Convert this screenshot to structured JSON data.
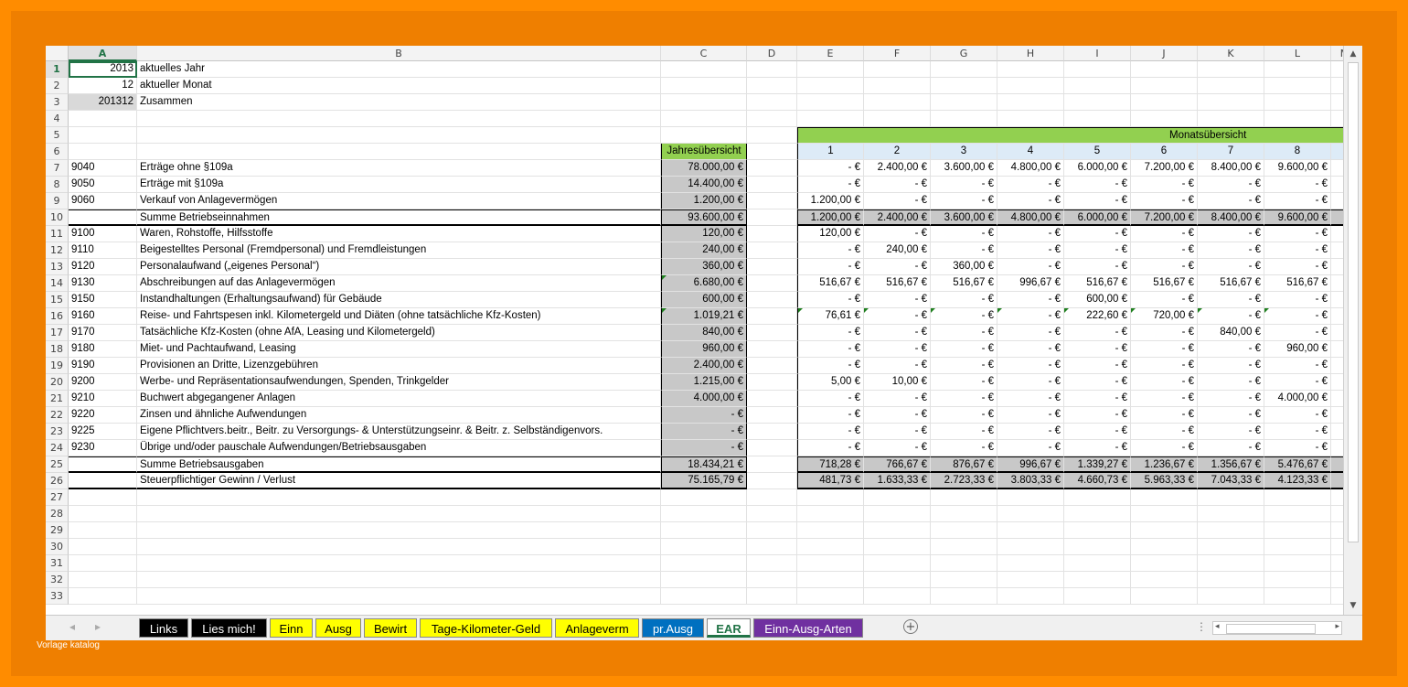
{
  "columns": [
    {
      "label": "A",
      "w": 75,
      "sel": true
    },
    {
      "label": "B",
      "w": 573
    },
    {
      "label": "C",
      "w": 94
    },
    {
      "label": "D",
      "w": 55
    },
    {
      "label": "E",
      "w": 73
    },
    {
      "label": "F",
      "w": 73
    },
    {
      "label": "G",
      "w": 73
    },
    {
      "label": "H",
      "w": 73
    },
    {
      "label": "I",
      "w": 73
    },
    {
      "label": "J",
      "w": 73
    },
    {
      "label": "K",
      "w": 73
    },
    {
      "label": "L",
      "w": 73
    },
    {
      "label": "M",
      "w": 30
    }
  ],
  "rows": [
    {
      "n": "1",
      "sel": true,
      "A": "2013",
      "B": "aktuelles Jahr"
    },
    {
      "n": "2",
      "A": "12",
      "B": "aktueller Monat"
    },
    {
      "n": "3",
      "A": "201312",
      "B": "Zusammen"
    },
    {
      "n": "4"
    },
    {
      "n": "5",
      "banner": "Monatsübersicht"
    },
    {
      "n": "6",
      "C": "Jahresübersicht",
      "months": [
        "1",
        "2",
        "3",
        "4",
        "5",
        "6",
        "7",
        "8"
      ]
    },
    {
      "n": "7",
      "A": "9040",
      "B": "Erträge ohne §109a",
      "C": "78.000,00 €",
      "vals": [
        "-   €",
        "2.400,00 €",
        "3.600,00 €",
        "4.800,00 €",
        "6.000,00 €",
        "7.200,00 €",
        "8.400,00 €",
        "9.600,00 €"
      ]
    },
    {
      "n": "8",
      "A": "9050",
      "B": "Erträge mit §109a",
      "C": "14.400,00 €",
      "vals": [
        "-   €",
        "-   €",
        "-   €",
        "-   €",
        "-   €",
        "-   €",
        "-   €",
        "-   €"
      ]
    },
    {
      "n": "9",
      "A": "9060",
      "B": "Verkauf von Anlagevermögen",
      "C": "1.200,00 €",
      "vals": [
        "1.200,00 €",
        "-   €",
        "-   €",
        "-   €",
        "-   €",
        "-   €",
        "-   €",
        "-   €"
      ]
    },
    {
      "n": "10",
      "sum": true,
      "B": "Summe Betriebseinnahmen",
      "C": "93.600,00 €",
      "vals": [
        "1.200,00 €",
        "2.400,00 €",
        "3.600,00 €",
        "4.800,00 €",
        "6.000,00 €",
        "7.200,00 €",
        "8.400,00 €",
        "9.600,00 €"
      ]
    },
    {
      "n": "11",
      "A": "9100",
      "B": "Waren, Rohstoffe, Hilfsstoffe",
      "C": "120,00 €",
      "vals": [
        "120,00 €",
        "-   €",
        "-   €",
        "-   €",
        "-   €",
        "-   €",
        "-   €",
        "-   €"
      ]
    },
    {
      "n": "12",
      "A": "9110",
      "B": "Beigestelltes Personal (Fremdpersonal) und Fremdleistungen",
      "C": "240,00 €",
      "vals": [
        "-   €",
        "240,00 €",
        "-   €",
        "-   €",
        "-   €",
        "-   €",
        "-   €",
        "-   €"
      ]
    },
    {
      "n": "13",
      "A": "9120",
      "B": "Personalaufwand („eigenes Personal“)",
      "C": "360,00 €",
      "vals": [
        "-   €",
        "-   €",
        "360,00 €",
        "-   €",
        "-   €",
        "-   €",
        "-   €",
        "-   €"
      ]
    },
    {
      "n": "14",
      "A": "9130",
      "B": "Abschreibungen auf das Anlagevermögen",
      "C": "6.680,00 €",
      "tri": true,
      "vals": [
        "516,67 €",
        "516,67 €",
        "516,67 €",
        "996,67 €",
        "516,67 €",
        "516,67 €",
        "516,67 €",
        "516,67 €"
      ]
    },
    {
      "n": "15",
      "A": "9150",
      "B": "Instandhaltungen (Erhaltungsaufwand) für Gebäude",
      "C": "600,00 €",
      "vals": [
        "-   €",
        "-   €",
        "-   €",
        "-   €",
        "600,00 €",
        "-   €",
        "-   €",
        "-   €"
      ]
    },
    {
      "n": "16",
      "A": "9160",
      "B": "Reise- und Fahrtspesen inkl. Kilometergeld und Diäten (ohne tatsächliche Kfz-Kosten)",
      "C": "1.019,21 €",
      "tri": true,
      "tris": true,
      "vals": [
        "76,61 €",
        "-   €",
        "-   €",
        "-   €",
        "222,60 €",
        "720,00 €",
        "-   €",
        "-   €"
      ]
    },
    {
      "n": "17",
      "A": "9170",
      "B": "Tatsächliche Kfz-Kosten (ohne AfA, Leasing und Kilometergeld)",
      "C": "840,00 €",
      "vals": [
        "-   €",
        "-   €",
        "-   €",
        "-   €",
        "-   €",
        "-   €",
        "840,00 €",
        "-   €"
      ]
    },
    {
      "n": "18",
      "A": "9180",
      "B": "Miet- und Pachtaufwand, Leasing",
      "C": "960,00 €",
      "vals": [
        "-   €",
        "-   €",
        "-   €",
        "-   €",
        "-   €",
        "-   €",
        "-   €",
        "960,00 €"
      ]
    },
    {
      "n": "19",
      "A": "9190",
      "B": "Provisionen an Dritte, Lizenzgebühren",
      "C": "2.400,00 €",
      "vals": [
        "-   €",
        "-   €",
        "-   €",
        "-   €",
        "-   €",
        "-   €",
        "-   €",
        "-   €"
      ]
    },
    {
      "n": "20",
      "A": "9200",
      "B": "Werbe- und Repräsentationsaufwendungen, Spenden, Trinkgelder",
      "C": "1.215,00 €",
      "vals": [
        "5,00 €",
        "10,00 €",
        "-   €",
        "-   €",
        "-   €",
        "-   €",
        "-   €",
        "-   €"
      ]
    },
    {
      "n": "21",
      "A": "9210",
      "B": "Buchwert abgegangener Anlagen",
      "C": "4.000,00 €",
      "vals": [
        "-   €",
        "-   €",
        "-   €",
        "-   €",
        "-   €",
        "-   €",
        "-   €",
        "4.000,00 €"
      ]
    },
    {
      "n": "22",
      "A": "9220",
      "B": "Zinsen und ähnliche Aufwendungen",
      "C": "-   €",
      "vals": [
        "-   €",
        "-   €",
        "-   €",
        "-   €",
        "-   €",
        "-   €",
        "-   €",
        "-   €"
      ]
    },
    {
      "n": "23",
      "A": "9225",
      "B": "Eigene Pflichtvers.beitr., Beitr. zu Versorgungs- & Unterstützungseinr. & Beitr. z. Selbständigenvors.",
      "C": "-   €",
      "vals": [
        "-   €",
        "-   €",
        "-   €",
        "-   €",
        "-   €",
        "-   €",
        "-   €",
        "-   €"
      ]
    },
    {
      "n": "24",
      "A": "9230",
      "B": "Übrige und/oder pauschale Aufwendungen/Betriebsausgaben",
      "C": "-   €",
      "vals": [
        "-   €",
        "-   €",
        "-   €",
        "-   €",
        "-   €",
        "-   €",
        "-   €",
        "-   €"
      ]
    },
    {
      "n": "25",
      "sum": true,
      "B": "Summe Betriebsausgaben",
      "C": "18.434,21 €",
      "vals": [
        "718,28 €",
        "766,67 €",
        "876,67 €",
        "996,67 €",
        "1.339,27 €",
        "1.236,67 €",
        "1.356,67 €",
        "5.476,67 €"
      ]
    },
    {
      "n": "26",
      "sum2": true,
      "B": "Steuerpflichtiger Gewinn / Verlust",
      "C": "75.165,79 €",
      "vals": [
        "481,73 €",
        "1.633,33 €",
        "2.723,33 €",
        "3.803,33 €",
        "4.660,73 €",
        "5.963,33 €",
        "7.043,33 €",
        "4.123,33 €"
      ]
    },
    {
      "n": "27"
    },
    {
      "n": "28"
    },
    {
      "n": "29"
    },
    {
      "n": "30"
    },
    {
      "n": "31"
    },
    {
      "n": "32"
    },
    {
      "n": "33"
    }
  ],
  "tabs": [
    {
      "label": "Links",
      "bg": "#000000",
      "fg": "#ffffff",
      "w": 54
    },
    {
      "label": "Lies mich!",
      "bg": "#000000",
      "fg": "#ffffff",
      "w": 83
    },
    {
      "label": "Einn",
      "bg": "#ffff00",
      "fg": "#000000",
      "w": 47
    },
    {
      "label": "Ausg",
      "bg": "#ffff00",
      "fg": "#000000",
      "w": 50
    },
    {
      "label": "Bewirt",
      "bg": "#ffff00",
      "fg": "#000000",
      "w": 58
    },
    {
      "label": "Tage-Kilometer-Geld",
      "bg": "#ffff00",
      "fg": "#000000",
      "w": 145
    },
    {
      "label": "Anlageverm",
      "bg": "#ffff00",
      "fg": "#000000",
      "w": 92
    },
    {
      "label": "pr.Ausg",
      "bg": "#0070c0",
      "fg": "#ffffff",
      "w": 68
    },
    {
      "label": "EAR",
      "active": true,
      "w": 48
    },
    {
      "label": "Einn-Ausg-Arten",
      "bg": "#7030a0",
      "fg": "#ffffff",
      "w": 120
    }
  ],
  "watermark": "Vorlage katalog",
  "colors": {
    "banner": "#92d050",
    "gray": "#c8c8c8",
    "accent": "#217346"
  }
}
